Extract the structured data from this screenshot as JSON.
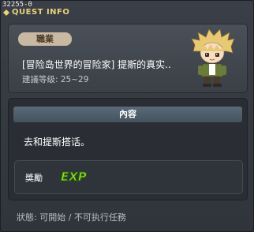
{
  "window": {
    "quest_id": "32255-0",
    "title": "QUEST INFO"
  },
  "quest": {
    "category": "職業",
    "name": "[冒险岛世界的冒险家] 提斯的真实..",
    "level": "建議等级: 25~29"
  },
  "content": {
    "header": "內容",
    "text": "去和提斯搭话。"
  },
  "reward": {
    "label": "獎勵",
    "exp_label": "EXP"
  },
  "status": "狀態: 可開始 / 不可执行任務",
  "colors": {
    "title": "#e8d27a",
    "badge_bg": "#c9b8a2",
    "exp_green": "#8be21f"
  },
  "icons": {
    "title": "quest-diamond-icon",
    "npc": "npc-portrait-icon",
    "exp": "exp-icon"
  }
}
